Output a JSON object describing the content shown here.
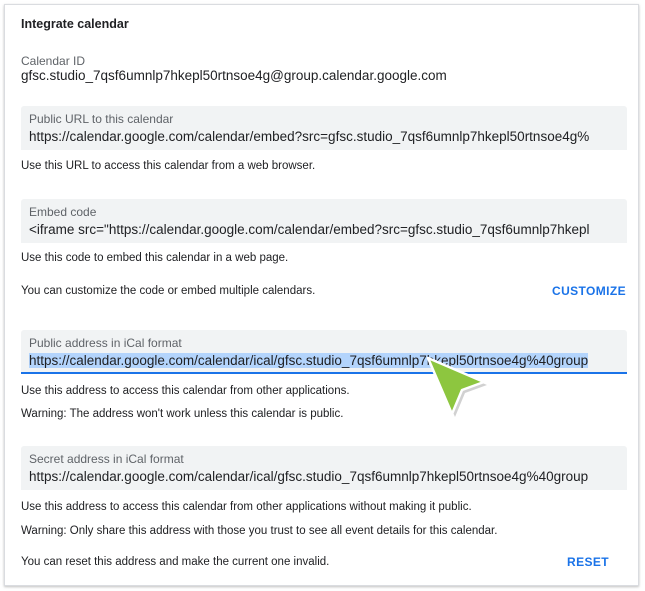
{
  "section": {
    "title": "Integrate calendar"
  },
  "calendar_id": {
    "label": "Calendar ID",
    "value": "gfsc.studio_7qsf6umnlp7hkepl50rtnsoe4g@group.calendar.google.com"
  },
  "public_url": {
    "label": "Public URL to this calendar",
    "value": "https://calendar.google.com/calendar/embed?src=gfsc.studio_7qsf6umnlp7hkepl50rtnsoe4g%",
    "help": "Use this URL to access this calendar from a web browser."
  },
  "embed_code": {
    "label": "Embed code",
    "value": "<iframe src=\"https://calendar.google.com/calendar/embed?src=gfsc.studio_7qsf6umnlp7hkepl",
    "help": "Use this code to embed this calendar in a web page.",
    "customize_text": "You can customize the code or embed multiple calendars.",
    "customize_button": "CUSTOMIZE"
  },
  "ical_public": {
    "label": "Public address in iCal format",
    "value": "https://calendar.google.com/calendar/ical/gfsc.studio_7qsf6umnlp7hkepl50rtnsoe4g%40group",
    "help": "Use this address to access this calendar from other applications.",
    "warning": "Warning: The address won't work unless this calendar is public."
  },
  "ical_secret": {
    "label": "Secret address in iCal format",
    "value": "https://calendar.google.com/calendar/ical/gfsc.studio_7qsf6umnlp7hkepl50rtnsoe4g%40group",
    "help": "Use this address to access this calendar from other applications without making it public.",
    "warning": "Warning: Only share this address with those you trust to see all event details for this calendar.",
    "reset_text": "You can reset this address and make the current one invalid.",
    "reset_button": "RESET"
  },
  "colors": {
    "accent": "#1a73e8",
    "field_bg": "#f1f3f4",
    "selection": "#b3d4fc",
    "cursor": "#8dc63f"
  },
  "icons": {
    "pointer": "cursor-arrow-icon"
  }
}
